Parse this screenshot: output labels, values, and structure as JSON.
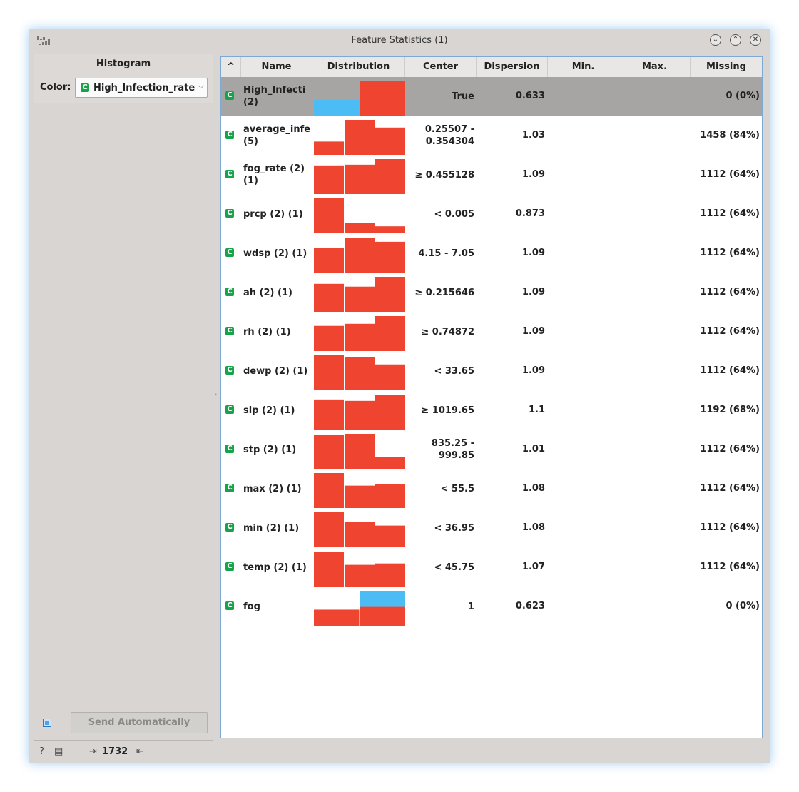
{
  "window": {
    "title": "Feature Statistics (1)",
    "minimize_icon": "chevron-down-icon",
    "maximize_icon": "chevron-up-icon",
    "close_icon": "close-icon"
  },
  "sidebar": {
    "histogram_title": "Histogram",
    "color_label": "Color:",
    "color_value": "High_Infection_rate",
    "send_label": "Send Automatically",
    "send_checked": true
  },
  "statusbar": {
    "count": "1732"
  },
  "table": {
    "columns": [
      "Name",
      "Distribution",
      "Center",
      "Dispersion",
      "Min.",
      "Max.",
      "Missing"
    ],
    "sort_indicator": "^",
    "colors": {
      "red": "#ee4430",
      "blue": "#4cbcf5",
      "badge": "#18a34a"
    },
    "rows": [
      {
        "name": [
          "High_Infecti",
          "(2)"
        ],
        "center": [
          "True"
        ],
        "dispersion": "0.633",
        "missing": "0 (0%)",
        "selected": true,
        "bars": [
          {
            "blue": 0.45,
            "red": 0
          },
          {
            "blue": 0,
            "red": 1.0
          }
        ]
      },
      {
        "name": [
          "average_infe",
          "(5)"
        ],
        "center": [
          "0.25507 -",
          "0.354304"
        ],
        "dispersion": "1.03",
        "missing": "1458 (84%)",
        "bars": [
          {
            "red": 0.38
          },
          {
            "red": 1.0
          },
          {
            "red": 0.78
          }
        ]
      },
      {
        "name": [
          "fog_rate (2)",
          "(1)"
        ],
        "center": [
          "≥ 0.455128"
        ],
        "dispersion": "1.09",
        "missing": "1112 (64%)",
        "bars": [
          {
            "red": 0.82
          },
          {
            "red": 0.84
          },
          {
            "red": 1.0
          }
        ]
      },
      {
        "name": [
          "prcp (2) (1)"
        ],
        "center": [
          "< 0.005"
        ],
        "dispersion": "0.873",
        "missing": "1112 (64%)",
        "bars": [
          {
            "red": 1.0
          },
          {
            "red": 0.29
          },
          {
            "red": 0.2
          }
        ]
      },
      {
        "name": [
          "wdsp (2) (1)"
        ],
        "center": [
          "4.15 - 7.05"
        ],
        "dispersion": "1.09",
        "missing": "1112 (64%)",
        "bars": [
          {
            "red": 0.7
          },
          {
            "red": 1.0
          },
          {
            "red": 0.88
          }
        ]
      },
      {
        "name": [
          "ah (2) (1)"
        ],
        "center": [
          "≥ 0.215646"
        ],
        "dispersion": "1.09",
        "missing": "1112 (64%)",
        "bars": [
          {
            "red": 0.8
          },
          {
            "red": 0.72
          },
          {
            "red": 1.0
          }
        ]
      },
      {
        "name": [
          "rh (2) (1)"
        ],
        "center": [
          "≥ 0.74872"
        ],
        "dispersion": "1.09",
        "missing": "1112 (64%)",
        "bars": [
          {
            "red": 0.72
          },
          {
            "red": 0.78
          },
          {
            "red": 1.0
          }
        ]
      },
      {
        "name": [
          "dewp (2) (1)"
        ],
        "center": [
          "< 33.65"
        ],
        "dispersion": "1.09",
        "missing": "1112 (64%)",
        "bars": [
          {
            "red": 1.0
          },
          {
            "red": 0.94
          },
          {
            "red": 0.74
          }
        ]
      },
      {
        "name": [
          "slp (2) (1)"
        ],
        "center": [
          "≥ 1019.65"
        ],
        "dispersion": "1.1",
        "missing": "1192 (68%)",
        "bars": [
          {
            "red": 0.86
          },
          {
            "red": 0.82
          },
          {
            "red": 1.0
          }
        ]
      },
      {
        "name": [
          "stp (2) (1)"
        ],
        "center": [
          "835.25 -",
          "999.85"
        ],
        "dispersion": "1.01",
        "missing": "1112 (64%)",
        "bars": [
          {
            "red": 0.98
          },
          {
            "red": 1.0
          },
          {
            "red": 0.34
          }
        ]
      },
      {
        "name": [
          "max (2) (1)"
        ],
        "center": [
          "< 55.5"
        ],
        "dispersion": "1.08",
        "missing": "1112 (64%)",
        "bars": [
          {
            "red": 1.0
          },
          {
            "red": 0.64
          },
          {
            "red": 0.68
          }
        ]
      },
      {
        "name": [
          "min (2) (1)"
        ],
        "center": [
          "< 36.95"
        ],
        "dispersion": "1.08",
        "missing": "1112 (64%)",
        "bars": [
          {
            "red": 1.0
          },
          {
            "red": 0.72
          },
          {
            "red": 0.62
          }
        ]
      },
      {
        "name": [
          "temp (2) (1)"
        ],
        "center": [
          "< 45.75"
        ],
        "dispersion": "1.07",
        "missing": "1112 (64%)",
        "bars": [
          {
            "red": 1.0
          },
          {
            "red": 0.62
          },
          {
            "red": 0.66
          }
        ]
      },
      {
        "name": [
          "fog"
        ],
        "center": [
          "1"
        ],
        "dispersion": "0.623",
        "missing": "0 (0%)",
        "bars": [
          {
            "red": 0.46,
            "blue": 0
          },
          {
            "red": 0.54,
            "blue": 0.46
          }
        ]
      }
    ]
  }
}
